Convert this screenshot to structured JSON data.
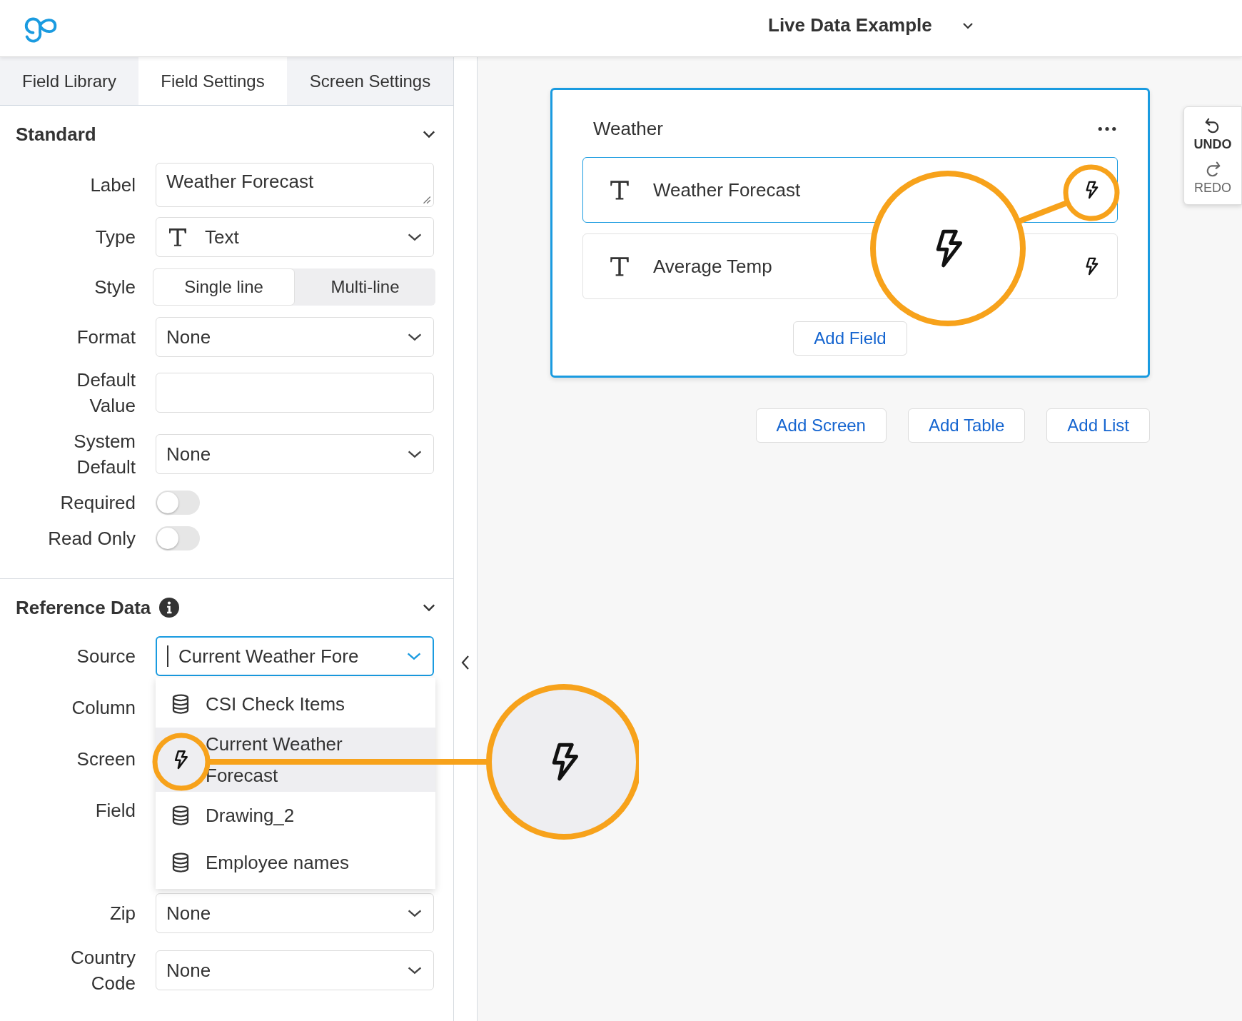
{
  "header": {
    "title": "Live Data Example"
  },
  "tabs": [
    {
      "label": "Field Library",
      "selected": false
    },
    {
      "label": "Field Settings",
      "selected": true
    },
    {
      "label": "Screen Settings",
      "selected": false
    }
  ],
  "standard": {
    "title": "Standard",
    "expanded": true,
    "rows": [
      {
        "kind": "textarea",
        "label": "Label",
        "value": "Weather Forecast"
      },
      {
        "kind": "type-select",
        "label": "Type",
        "value": "Text"
      },
      {
        "kind": "segmented",
        "label": "Style",
        "options": [
          {
            "label": "Single line",
            "selected": true
          },
          {
            "label": "Multi-line",
            "selected": false
          }
        ]
      },
      {
        "kind": "select",
        "label": "Format",
        "value": "None"
      },
      {
        "kind": "input",
        "label": "Default Value"
      },
      {
        "kind": "select",
        "label": "System Default",
        "value": "None"
      },
      {
        "kind": "toggle",
        "label": "Required",
        "on": false
      },
      {
        "kind": "toggle",
        "label": "Read Only",
        "on": false
      }
    ]
  },
  "reference": {
    "title": "Reference Data",
    "expanded": true,
    "source": {
      "label": "Source",
      "value": "Current Weather Fore",
      "focused": true,
      "open": true,
      "options": [
        {
          "kind": "table",
          "label": "CSI Check Items",
          "selected": false
        },
        {
          "kind": "live",
          "label": "Current Weather Forecast",
          "selected": true
        },
        {
          "kind": "table",
          "label": "Drawing_2",
          "selected": false
        },
        {
          "kind": "table",
          "label": "Employee names",
          "selected": false
        }
      ]
    },
    "rows": [
      {
        "kind": "covered",
        "label": "Column"
      },
      {
        "kind": "covered",
        "label": "Screen"
      },
      {
        "kind": "covered",
        "label": "Field"
      },
      {
        "kind": "hidden"
      },
      {
        "kind": "select",
        "label": "Zip",
        "value": "None"
      },
      {
        "kind": "select",
        "label": "Country Code",
        "value": "None"
      }
    ]
  },
  "screen": {
    "title": "Weather",
    "selected": true,
    "fields": [
      {
        "label": "Weather Forecast",
        "selected": true
      },
      {
        "label": "Average Temp",
        "selected": false
      }
    ],
    "add_field": "Add Field"
  },
  "buttons": [
    "Add Screen",
    "Add Table",
    "Add List"
  ],
  "history": [
    {
      "label": "UNDO",
      "disabled": false
    },
    {
      "label": "REDO",
      "disabled": true
    }
  ]
}
